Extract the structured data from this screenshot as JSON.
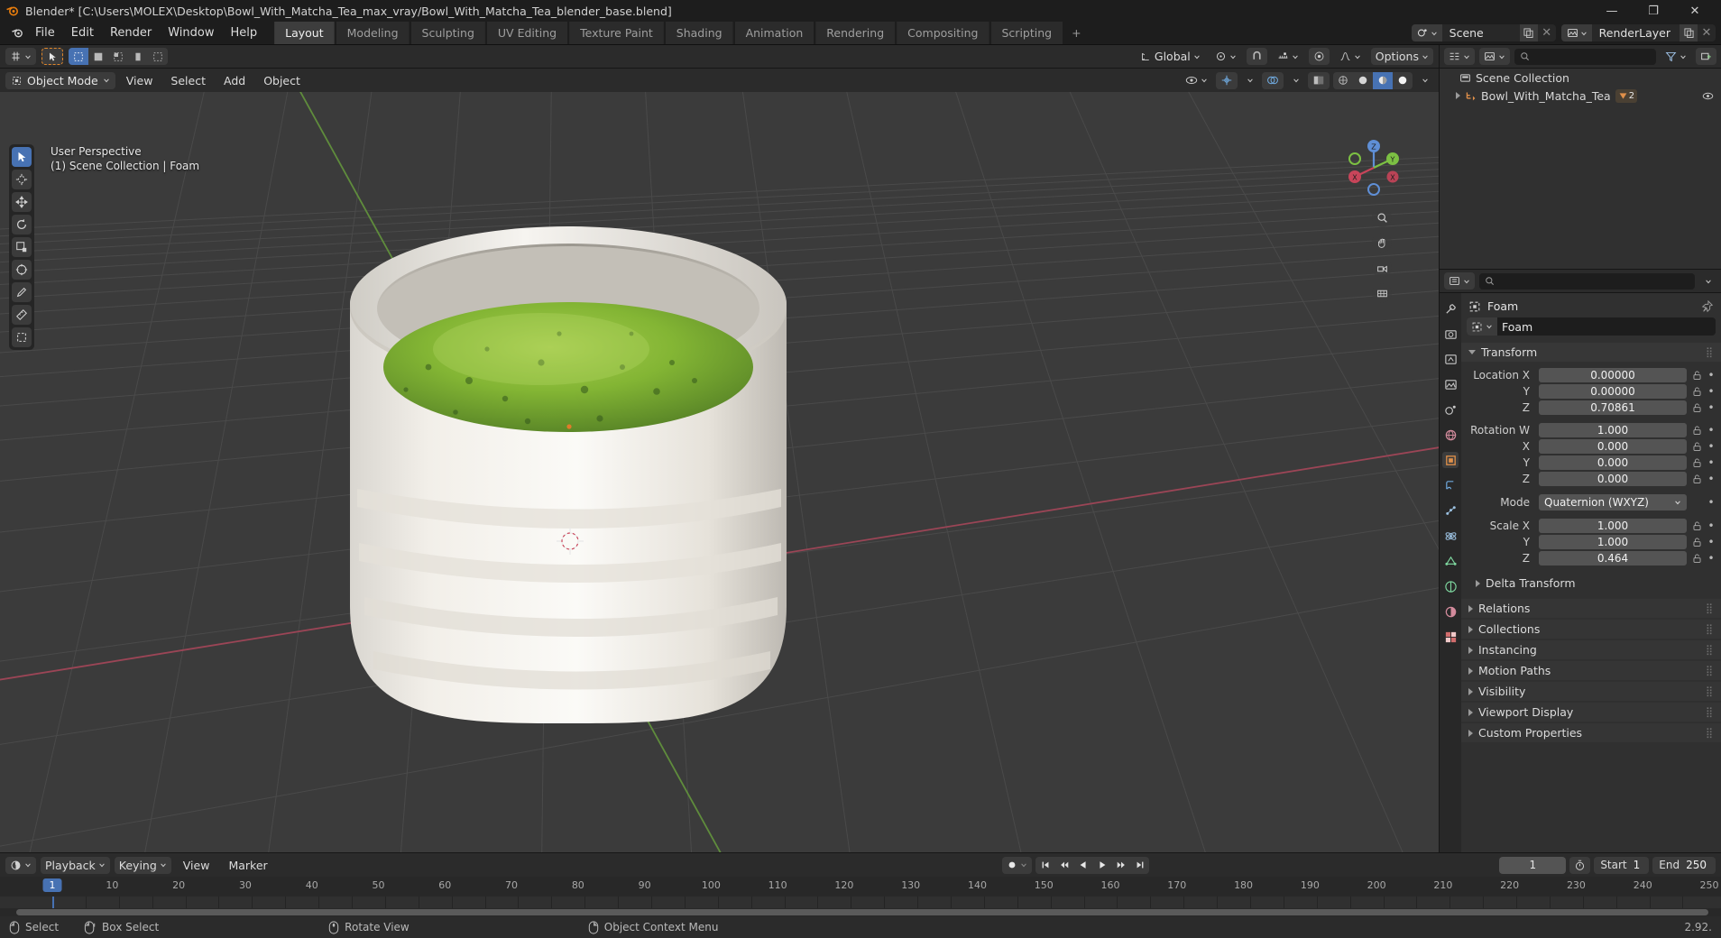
{
  "window": {
    "title": "Blender* [C:\\Users\\MOLEX\\Desktop\\Bowl_With_Matcha_Tea_max_vray/Bowl_With_Matcha_Tea_blender_base.blend]",
    "minimize": "—",
    "maximize": "❐",
    "close": "✕"
  },
  "topbar": {
    "menus": [
      "File",
      "Edit",
      "Render",
      "Window",
      "Help"
    ],
    "tabs": [
      {
        "label": "Layout",
        "active": true
      },
      {
        "label": "Modeling",
        "active": false
      },
      {
        "label": "Sculpting",
        "active": false
      },
      {
        "label": "UV Editing",
        "active": false
      },
      {
        "label": "Texture Paint",
        "active": false
      },
      {
        "label": "Shading",
        "active": false
      },
      {
        "label": "Animation",
        "active": false
      },
      {
        "label": "Rendering",
        "active": false
      },
      {
        "label": "Compositing",
        "active": false
      },
      {
        "label": "Scripting",
        "active": false
      }
    ],
    "add_tab": "+",
    "scene_name": "Scene",
    "viewlayer_name": "RenderLayer"
  },
  "viewport": {
    "transform_orientation": "Global",
    "options_label": "Options",
    "mode": "Object Mode",
    "menus": [
      "View",
      "Select",
      "Add",
      "Object"
    ],
    "overlay_line1": "User Perspective",
    "overlay_line2": "(1) Scene Collection | Foam"
  },
  "outliner": {
    "search_placeholder": "",
    "rows": [
      {
        "label": "Scene Collection",
        "indent": 0,
        "icon": "collection-icon",
        "expander": "none",
        "badge": ""
      },
      {
        "label": "Bowl_With_Matcha_Tea",
        "indent": 1,
        "icon": "object-icon",
        "expander": "right",
        "badge": "2"
      }
    ]
  },
  "properties": {
    "breadcrumb": "Foam",
    "object_name": "Foam",
    "panels": [
      {
        "title": "Transform",
        "open": true
      },
      {
        "title": "Delta Transform",
        "open": false,
        "sub": true
      },
      {
        "title": "Relations",
        "open": false
      },
      {
        "title": "Collections",
        "open": false
      },
      {
        "title": "Instancing",
        "open": false
      },
      {
        "title": "Motion Paths",
        "open": false
      },
      {
        "title": "Visibility",
        "open": false
      },
      {
        "title": "Viewport Display",
        "open": false
      },
      {
        "title": "Custom Properties",
        "open": false
      }
    ],
    "transform": {
      "location": [
        {
          "label": "Location X",
          "value": "0.00000"
        },
        {
          "label": "Y",
          "value": "0.00000"
        },
        {
          "label": "Z",
          "value": "0.70861"
        }
      ],
      "rotation": [
        {
          "label": "Rotation W",
          "value": "1.000"
        },
        {
          "label": "X",
          "value": "0.000"
        },
        {
          "label": "Y",
          "value": "0.000"
        },
        {
          "label": "Z",
          "value": "0.000"
        }
      ],
      "mode_label": "Mode",
      "mode_value": "Quaternion (WXYZ)",
      "scale": [
        {
          "label": "Scale X",
          "value": "1.000"
        },
        {
          "label": "Y",
          "value": "1.000"
        },
        {
          "label": "Z",
          "value": "0.464"
        }
      ]
    }
  },
  "timeline": {
    "menus": [
      "Playback",
      "Keying",
      "View",
      "Marker"
    ],
    "current_frame": "1",
    "start_label": "Start",
    "start_value": "1",
    "end_label": "End",
    "end_value": "250",
    "ticks": [
      10,
      20,
      30,
      40,
      50,
      60,
      70,
      80,
      90,
      100,
      110,
      120,
      130,
      140,
      150,
      160,
      170,
      180,
      190,
      200,
      210,
      220,
      230,
      240,
      250
    ],
    "playhead_frame": 1
  },
  "statusbar": {
    "items": [
      {
        "icon": "mouse-left-icon",
        "label": "Select"
      },
      {
        "icon": "mouse-drag-icon",
        "label": "Box Select"
      },
      {
        "icon": "mouse-middle-icon",
        "label": "Rotate View"
      },
      {
        "icon": "mouse-right-icon",
        "label": "Object Context Menu"
      }
    ],
    "version": "2.92."
  },
  "colors": {
    "accent": "#4772b3",
    "x_axis": "#c8455a",
    "y_axis": "#7cc043",
    "panel_bg": "#303030",
    "header_bg": "#2b2b2b",
    "viewport_bg": "#3b3b3b"
  }
}
